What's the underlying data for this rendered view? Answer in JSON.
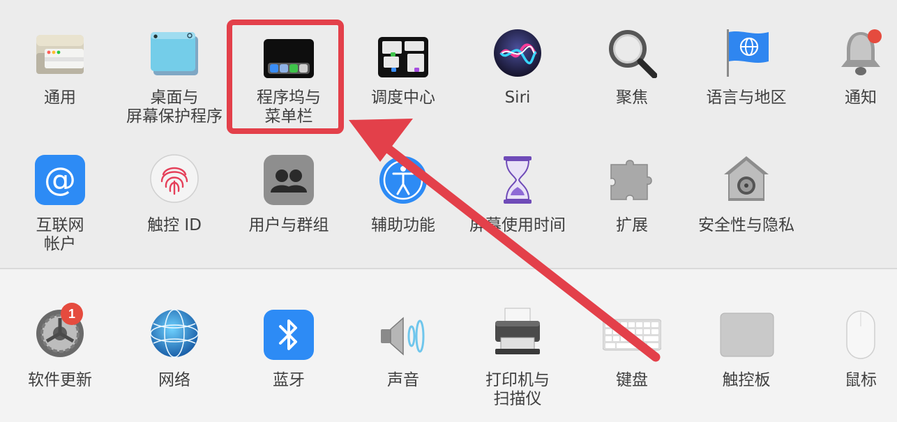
{
  "panes_row1": [
    {
      "id": "general",
      "label": [
        "通用"
      ],
      "icon": "general-icon"
    },
    {
      "id": "desktop",
      "label": [
        "桌面与",
        "屏幕保护程序"
      ],
      "icon": "desktop-screensaver-icon"
    },
    {
      "id": "dock",
      "label": [
        "程序坞与",
        "菜单栏"
      ],
      "icon": "dock-menubar-icon"
    },
    {
      "id": "mission",
      "label": [
        "调度中心"
      ],
      "icon": "mission-control-icon"
    },
    {
      "id": "siri",
      "label": [
        "Siri"
      ],
      "icon": "siri-icon"
    },
    {
      "id": "spotlight",
      "label": [
        "聚焦"
      ],
      "icon": "spotlight-magnifier-icon"
    },
    {
      "id": "language",
      "label": [
        "语言与地区"
      ],
      "icon": "globe-flag-icon"
    },
    {
      "id": "notifications",
      "label": [
        "通知"
      ],
      "icon": "bell-icon"
    }
  ],
  "panes_row2": [
    {
      "id": "internet",
      "label": [
        "互联网",
        "帐户"
      ],
      "icon": "at-sign-icon"
    },
    {
      "id": "touchid",
      "label": [
        "触控 ID"
      ],
      "icon": "fingerprint-icon"
    },
    {
      "id": "users",
      "label": [
        "用户与群组"
      ],
      "icon": "users-groups-icon"
    },
    {
      "id": "accessibility",
      "label": [
        "辅助功能"
      ],
      "icon": "accessibility-icon"
    },
    {
      "id": "screentime",
      "label": [
        "屏幕使用时间"
      ],
      "icon": "hourglass-icon"
    },
    {
      "id": "extensions",
      "label": [
        "扩展"
      ],
      "icon": "puzzle-icon"
    },
    {
      "id": "security",
      "label": [
        "安全性与隐私"
      ],
      "icon": "house-safe-icon"
    }
  ],
  "panes_row3": [
    {
      "id": "update",
      "label": [
        "软件更新"
      ],
      "icon": "gear-icon",
      "badge": "1"
    },
    {
      "id": "network",
      "label": [
        "网络"
      ],
      "icon": "network-globe-icon"
    },
    {
      "id": "bluetooth",
      "label": [
        "蓝牙"
      ],
      "icon": "bluetooth-icon"
    },
    {
      "id": "sound",
      "label": [
        "声音"
      ],
      "icon": "speaker-icon"
    },
    {
      "id": "printers",
      "label": [
        "打印机与",
        "扫描仪"
      ],
      "icon": "printer-icon"
    },
    {
      "id": "keyboard",
      "label": [
        "键盘"
      ],
      "icon": "keyboard-icon"
    },
    {
      "id": "trackpad",
      "label": [
        "触控板"
      ],
      "icon": "trackpad-icon"
    },
    {
      "id": "mouse",
      "label": [
        "鼠标"
      ],
      "icon": "mouse-icon"
    }
  ],
  "annotation": {
    "highlighted_pane": "dock",
    "color": "#e3404a"
  }
}
